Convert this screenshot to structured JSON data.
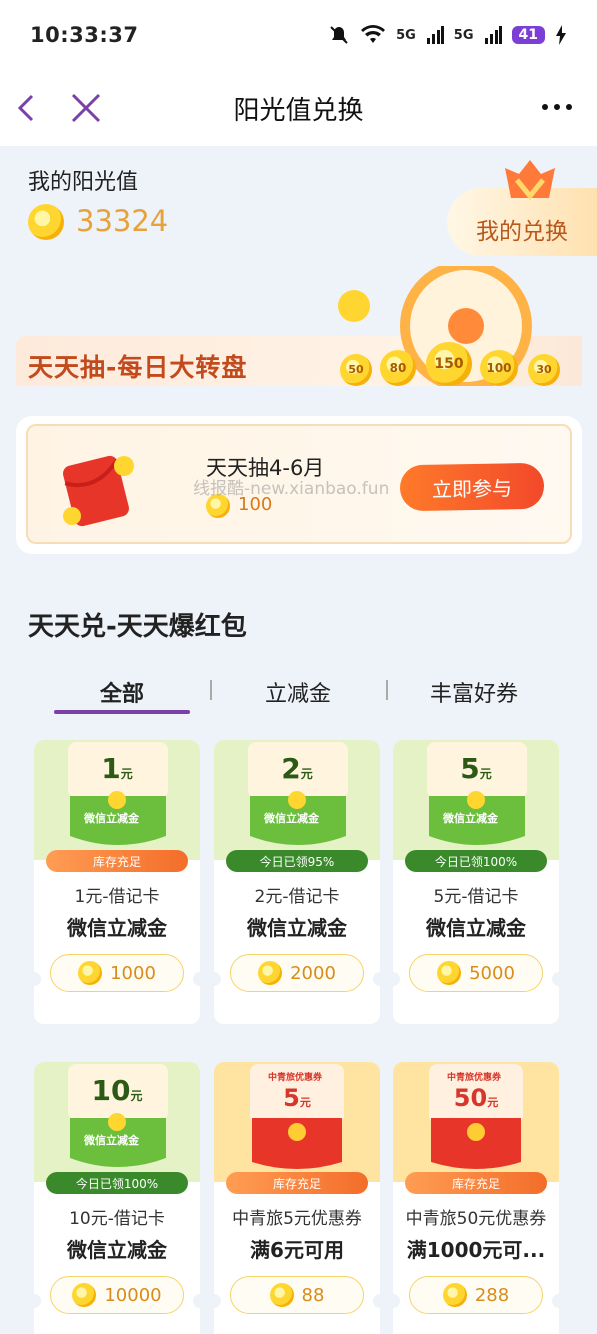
{
  "status": {
    "time": "10:33:37",
    "net1": "5G",
    "net2": "5G",
    "battery": "41"
  },
  "nav": {
    "title": "阳光值兑换"
  },
  "mine": {
    "label": "我的阳光值",
    "value": "33324",
    "exchange": "我的兑换"
  },
  "wheel": {
    "title": "天天抽-每日大转盘",
    "wheel_labels": [
      "50",
      "80",
      "150",
      "100",
      "30"
    ]
  },
  "draw": {
    "name": "天天抽4-6月",
    "cost": "100",
    "button": "立即参与",
    "watermark": "线报酷-new.xianbao.fun"
  },
  "section": {
    "title": "天天兑-天天爆红包"
  },
  "tabs": [
    {
      "label": "全部"
    },
    {
      "label": "立减金"
    },
    {
      "label": "丰富好券"
    }
  ],
  "cards": [
    {
      "amount": "1",
      "unit": "元",
      "tag": "微信立减金",
      "badge": "库存充足",
      "line1": "1元-借记卡",
      "line2": "微信立减金",
      "price": "1000",
      "theme": "green"
    },
    {
      "amount": "2",
      "unit": "元",
      "tag": "微信立减金",
      "badge": "今日已领95%",
      "badge_progress": 95,
      "line1": "2元-借记卡",
      "line2": "微信立减金",
      "price": "2000",
      "theme": "green"
    },
    {
      "amount": "5",
      "unit": "元",
      "tag": "微信立减金",
      "badge": "今日已领100%",
      "badge_progress": 100,
      "line1": "5元-借记卡",
      "line2": "微信立减金",
      "price": "5000",
      "theme": "green"
    },
    {
      "amount": "10",
      "unit": "元",
      "tag": "微信立减金",
      "badge": "今日已领100%",
      "badge_progress": 100,
      "line1": "10元-借记卡",
      "line2": "微信立减金",
      "price": "10000",
      "theme": "green"
    },
    {
      "amount": "5",
      "unit": "元",
      "tag": "中青旅优惠券",
      "badge": "库存充足",
      "line1": "中青旅5元优惠券",
      "line2": "满6元可用",
      "price": "88",
      "theme": "red"
    },
    {
      "amount": "50",
      "unit": "元",
      "tag": "中青旅优惠券",
      "badge": "库存充足",
      "line1": "中青旅50元优惠券",
      "line2": "满1000元可...",
      "price": "288",
      "theme": "red"
    }
  ],
  "colors": {
    "accent": "#7b3fa8",
    "coin": "#ffd630",
    "orange": "#f36d2a"
  }
}
